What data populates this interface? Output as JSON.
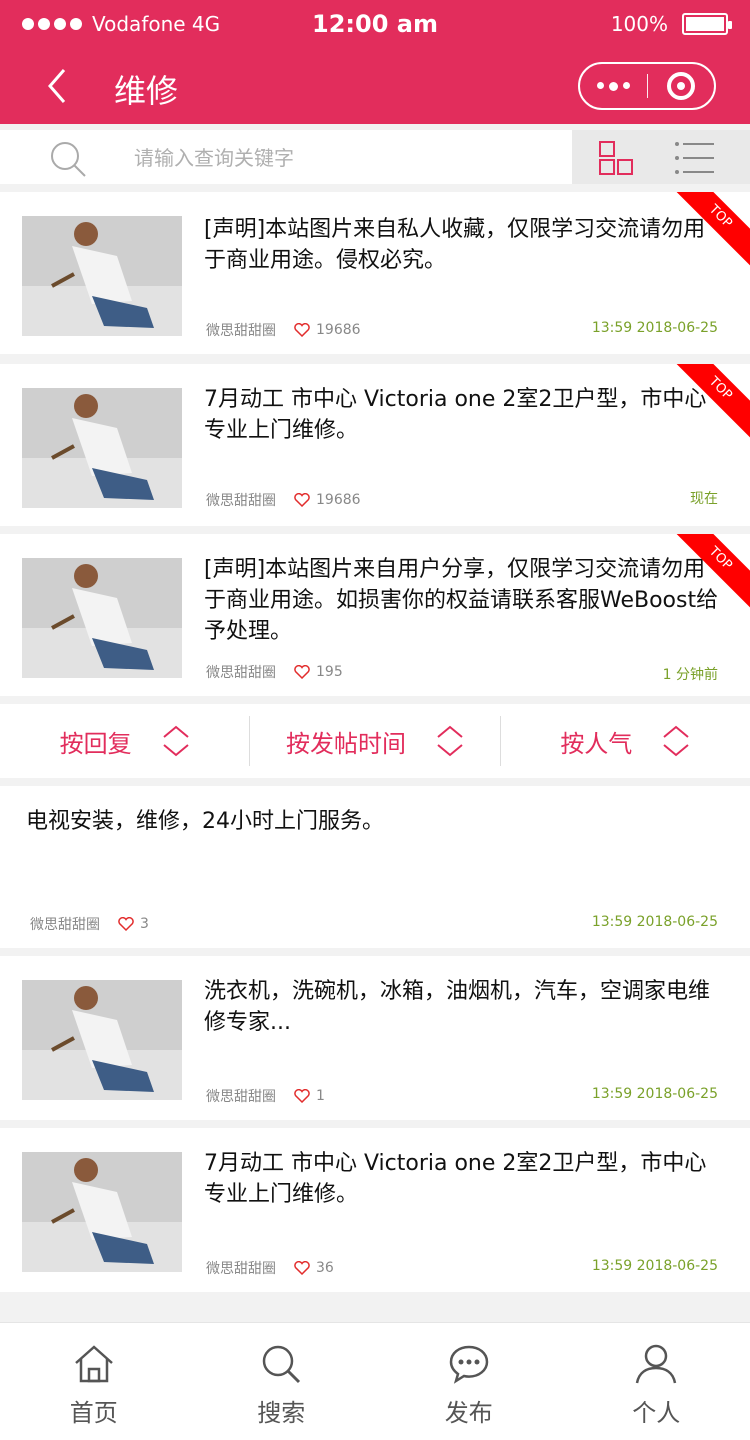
{
  "status": {
    "carrier": "Vodafone 4G",
    "time": "12:00 am",
    "battery": "100%"
  },
  "nav": {
    "title": "维修"
  },
  "search": {
    "placeholder": "请输入查询关键字"
  },
  "cards_top": [
    {
      "text": "[声明]本站图片来自私人收藏，仅限学习交流请勿用于商业用途。侵权必究。",
      "author": "微思甜甜圈",
      "likes": "19686",
      "time": "13:59 2018-06-25",
      "top": "TOP"
    },
    {
      "text": "7月动工 市中心 Victoria one 2室2卫户型，市中心专业上门维修。",
      "author": "微思甜甜圈",
      "likes": "19686",
      "time": "现在",
      "top": "TOP"
    },
    {
      "text": "[声明]本站图片来自用户分享，仅限学习交流请勿用于商业用途。如损害你的权益请联系客服WeBoost给予处理。",
      "author": "微思甜甜圈",
      "likes": "195",
      "time": "1 分钟前",
      "top": "TOP"
    }
  ],
  "sort": {
    "reply": "按回复",
    "post_time": "按发帖时间",
    "popularity": "按人气"
  },
  "cards_bottom": [
    {
      "text": "电视安装，维修，24小时上门服务。",
      "author": "微思甜甜圈",
      "likes": "3",
      "time": "13:59 2018-06-25"
    },
    {
      "text": "洗衣机，洗碗机，冰箱，油烟机，汽车，空调家电维修专家...",
      "author": "微思甜甜圈",
      "likes": "1",
      "time": "13:59 2018-06-25"
    },
    {
      "text": "7月动工 市中心 Victoria one 2室2卫户型，市中心专业上门维修。",
      "author": "微思甜甜圈",
      "likes": "36",
      "time": "13:59 2018-06-25"
    }
  ],
  "tabs": [
    {
      "label": "首页",
      "icon": "home-icon"
    },
    {
      "label": "搜索",
      "icon": "search-icon"
    },
    {
      "label": "发布",
      "icon": "chat-icon"
    },
    {
      "label": "个人",
      "icon": "user-icon"
    }
  ],
  "colors": {
    "brand": "#e22d5c",
    "time_green": "#7aa12a",
    "ribbon_red": "#ff0000"
  }
}
